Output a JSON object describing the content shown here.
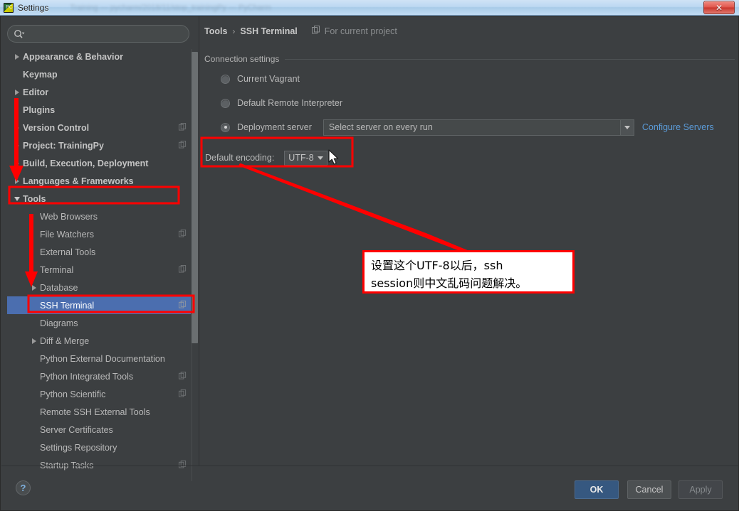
{
  "window": {
    "title": "Settings",
    "icon": "pycharm-logo-icon",
    "close_label": "✕"
  },
  "search": {
    "value": "",
    "placeholder": ""
  },
  "sidebar": {
    "items": [
      {
        "label": "Appearance & Behavior",
        "level": 0,
        "arrow": "right",
        "copy": false,
        "selected": false
      },
      {
        "label": "Keymap",
        "level": 0,
        "arrow": "none",
        "copy": false,
        "selected": false
      },
      {
        "label": "Editor",
        "level": 0,
        "arrow": "right",
        "copy": false,
        "selected": false
      },
      {
        "label": "Plugins",
        "level": 0,
        "arrow": "none",
        "copy": false,
        "selected": false
      },
      {
        "label": "Version Control",
        "level": 0,
        "arrow": "right",
        "copy": true,
        "selected": false
      },
      {
        "label": "Project: TrainingPy",
        "level": 0,
        "arrow": "right",
        "copy": true,
        "selected": false
      },
      {
        "label": "Build, Execution, Deployment",
        "level": 0,
        "arrow": "right",
        "copy": false,
        "selected": false
      },
      {
        "label": "Languages & Frameworks",
        "level": 0,
        "arrow": "right",
        "copy": false,
        "selected": false
      },
      {
        "label": "Tools",
        "level": 0,
        "arrow": "down",
        "copy": false,
        "selected": false
      },
      {
        "label": "Web Browsers",
        "level": 1,
        "arrow": "none",
        "copy": false,
        "selected": false
      },
      {
        "label": "File Watchers",
        "level": 1,
        "arrow": "none",
        "copy": true,
        "selected": false
      },
      {
        "label": "External Tools",
        "level": 1,
        "arrow": "none",
        "copy": false,
        "selected": false
      },
      {
        "label": "Terminal",
        "level": 1,
        "arrow": "none",
        "copy": true,
        "selected": false
      },
      {
        "label": "Database",
        "level": 1,
        "arrow": "right",
        "copy": false,
        "selected": false
      },
      {
        "label": "SSH Terminal",
        "level": 1,
        "arrow": "none",
        "copy": true,
        "selected": true
      },
      {
        "label": "Diagrams",
        "level": 1,
        "arrow": "none",
        "copy": false,
        "selected": false
      },
      {
        "label": "Diff & Merge",
        "level": 1,
        "arrow": "right",
        "copy": false,
        "selected": false
      },
      {
        "label": "Python External Documentation",
        "level": 1,
        "arrow": "none",
        "copy": false,
        "selected": false
      },
      {
        "label": "Python Integrated Tools",
        "level": 1,
        "arrow": "none",
        "copy": true,
        "selected": false
      },
      {
        "label": "Python Scientific",
        "level": 1,
        "arrow": "none",
        "copy": true,
        "selected": false
      },
      {
        "label": "Remote SSH External Tools",
        "level": 1,
        "arrow": "none",
        "copy": false,
        "selected": false
      },
      {
        "label": "Server Certificates",
        "level": 1,
        "arrow": "none",
        "copy": false,
        "selected": false
      },
      {
        "label": "Settings Repository",
        "level": 1,
        "arrow": "none",
        "copy": false,
        "selected": false
      },
      {
        "label": "Startup Tasks",
        "level": 1,
        "arrow": "none",
        "copy": true,
        "selected": false
      }
    ]
  },
  "breadcrumb": {
    "root": "Tools",
    "separator": "›",
    "current": "SSH Terminal",
    "scope_label": "For current project"
  },
  "main": {
    "group_title": "Connection settings",
    "radios": [
      {
        "label": "Current Vagrant",
        "checked": false
      },
      {
        "label": "Default Remote Interpreter",
        "checked": false
      },
      {
        "label": "Deployment server",
        "checked": true
      }
    ],
    "server_select": {
      "value": "Select server on every run"
    },
    "configure_servers_link": "Configure Servers",
    "encoding": {
      "label": "Default encoding:",
      "value": "UTF-8"
    }
  },
  "footer": {
    "help_label": "?",
    "ok_label": "OK",
    "cancel_label": "Cancel",
    "apply_label": "Apply"
  },
  "annotation": {
    "callout_line1": "设置这个UTF-8以后，ssh",
    "callout_line2": "session则中文乱码问题解决。",
    "color": "#ff0000"
  },
  "colors": {
    "background": "#3c3f41",
    "selection": "#4b6eaf",
    "link": "#5b9bd8",
    "ok_button": "#365880",
    "annotation_red": "#ff0000"
  }
}
